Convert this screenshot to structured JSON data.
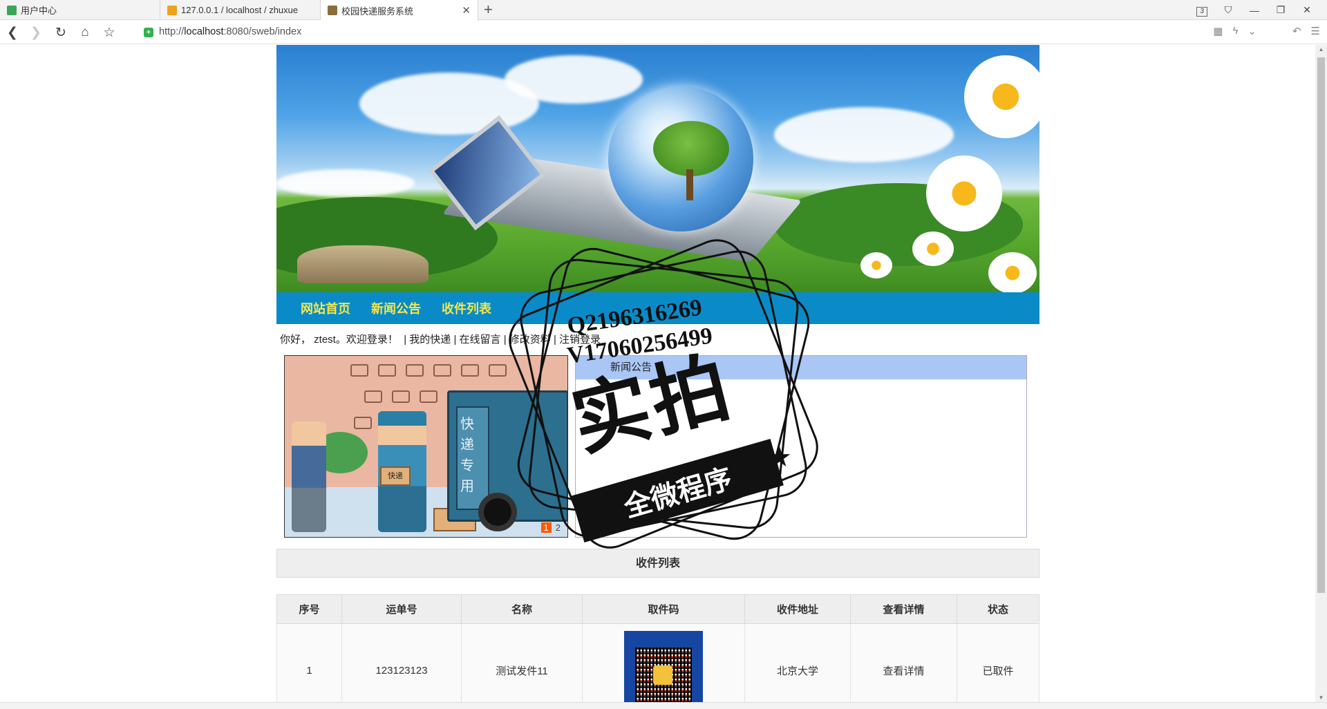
{
  "browser": {
    "tabs": [
      {
        "title": "用户中心",
        "active": false
      },
      {
        "title": "127.0.0.1 / localhost / zhuxue",
        "active": false
      },
      {
        "title": "校园快递服务系统",
        "active": true
      }
    ],
    "tab_count_badge": "3",
    "url_prefix": "http://",
    "url_host": "localhost",
    "url_rest": ":8080/sweb/index"
  },
  "nav": {
    "items": [
      {
        "label": "网站首页"
      },
      {
        "label": "新闻公告"
      },
      {
        "label": "收件列表"
      }
    ]
  },
  "welcome": {
    "greeting": "你好， ztest。欢迎登录！",
    "links": [
      "我的快递",
      "在线留言",
      "修改资料",
      "注销登录"
    ]
  },
  "slider": {
    "truck_text": "快递专用",
    "box_label": "快递",
    "pages": [
      "1",
      "2"
    ],
    "current": "1"
  },
  "notice": {
    "title": "新闻公告"
  },
  "list": {
    "title": "收件列表",
    "headers": [
      "序号",
      "运单号",
      "名称",
      "取件码",
      "收件地址",
      "查看详情",
      "状态"
    ],
    "rows": [
      {
        "index": "1",
        "waybill": "123123123",
        "name": "测试发件11",
        "address": "北京大学",
        "detail": "查看详情",
        "status": "已取件"
      }
    ]
  },
  "watermark": {
    "line1": "Q2196316269",
    "line2": "V17060256499",
    "big": "实拍",
    "band": "全微程序"
  },
  "colors": {
    "menu_bg": "#0a8bc8",
    "menu_text": "#f5e74a",
    "notice_head": "#a9c6f5"
  }
}
